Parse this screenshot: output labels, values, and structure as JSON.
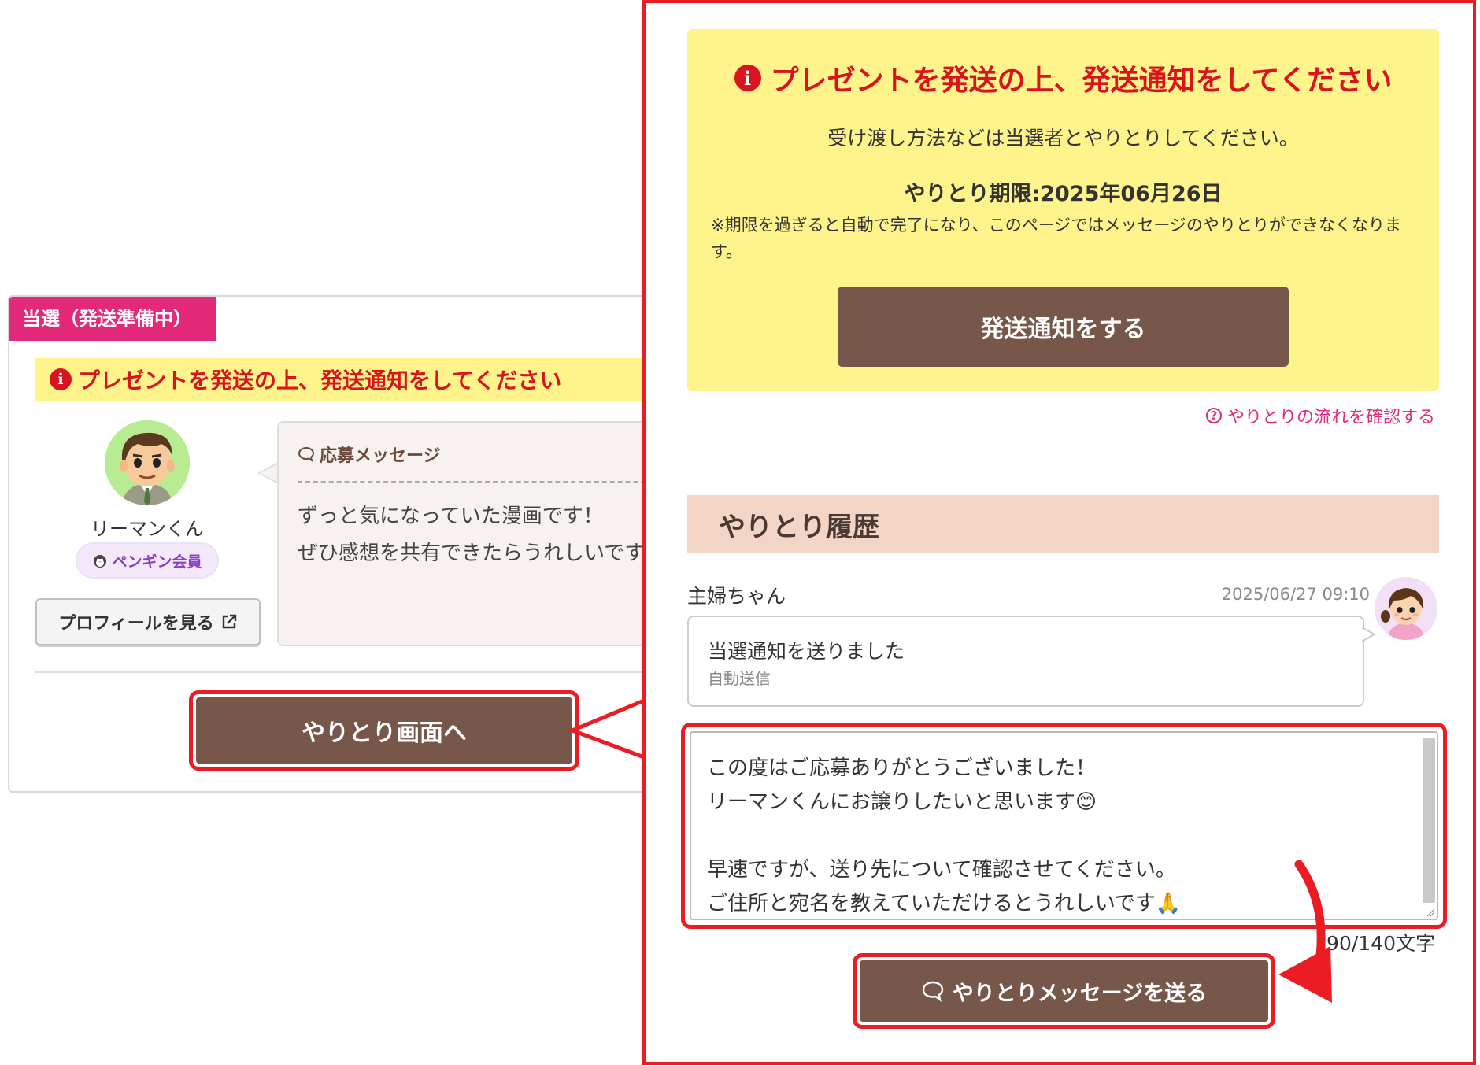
{
  "left_card": {
    "status_tag": "当選（発送準備中）",
    "banner_text": "プレゼントを発送の上、発送通知をしてください",
    "user_name": "リーマンくん",
    "member_badge": "ペンギン会員",
    "profile_button": "プロフィールを見る",
    "message_heading": "応募メッセージ",
    "message_lines": [
      "ずっと気になっていた漫画です！",
      "ぜひ感想を共有できたらうれしいです"
    ],
    "to_chat_button": "やりとり画面へ"
  },
  "right_panel": {
    "notice_title": "プレゼントを発送の上、発送通知をしてください",
    "notice_sub": "受け渡し方法などは当選者とやりとりしてください。",
    "deadline": "やりとり期限:2025年06月26日",
    "note": "※期限を過ぎると自動で完了になり、このページではメッセージのやりとりができなくなります。",
    "notify_button": "発送通知をする",
    "flow_link": "やりとりの流れを確認する",
    "history_heading": "やりとり履歴",
    "history": {
      "sender": "主婦ちゃん",
      "time": "2025/06/27 09:10",
      "text": "当選通知を送りました",
      "sub": "自動送信"
    },
    "compose_lines": [
      "この度はご応募ありがとうございました！",
      "リーマンくんにお譲りしたいと思います😊",
      "",
      "早速ですが、送り先について確認させてください。",
      "ご住所と宛名を教えていただけるとうれしいです🙏"
    ],
    "char_count": "90/140文字",
    "send_button": "やりとりメッセージを送る"
  },
  "colors": {
    "accent_red": "#ec1c24",
    "warning_red": "#d8141e",
    "brand_brown": "#76574a",
    "banner_yellow": "#fff38c",
    "status_pink": "#e4287a",
    "history_peach": "#f3d5c6"
  },
  "icons": [
    "info-icon",
    "penguin-icon",
    "external-link-icon",
    "speech-bubble-icon",
    "question-circle-icon",
    "chat-bubble-icon",
    "resize-grip-icon"
  ]
}
